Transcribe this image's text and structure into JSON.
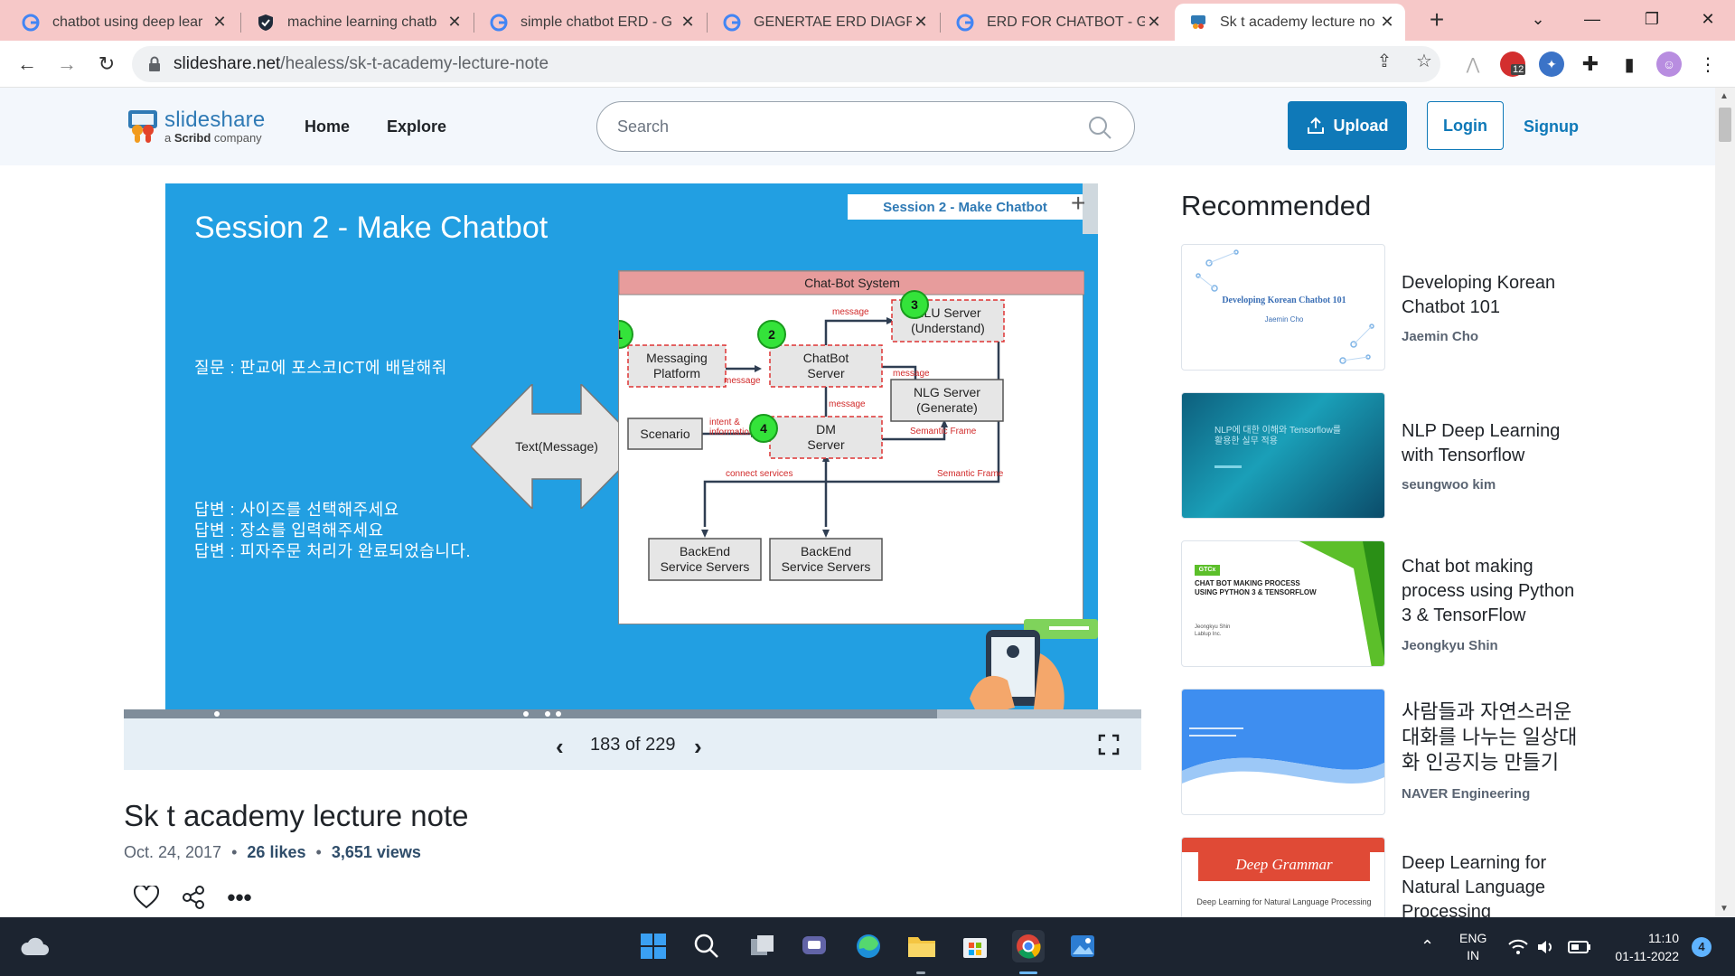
{
  "browser": {
    "tabs": [
      {
        "title": "chatbot using deep lear",
        "favicon": "google-icon"
      },
      {
        "title": "machine learning chatb",
        "favicon": "shield-icon"
      },
      {
        "title": "simple chatbot ERD - G",
        "favicon": "google-icon"
      },
      {
        "title": "GENERTAE ERD DIAGRA",
        "favicon": "google-icon"
      },
      {
        "title": "ERD FOR CHATBOT - Go",
        "favicon": "google-icon"
      },
      {
        "title": "Sk t academy lecture no",
        "favicon": "slideshare-icon",
        "active": true
      }
    ],
    "url_host": "slideshare.net",
    "url_path": "/healess/sk-t-academy-lecture-note",
    "extension_badge": "12"
  },
  "header": {
    "logo_name": "slideshare",
    "logo_sub_prefix": "a ",
    "logo_sub_brand": "Scribd",
    "logo_sub_suffix": " company",
    "nav": [
      "Home",
      "Explore"
    ],
    "search_placeholder": "Search",
    "upload_label": "Upload",
    "login_label": "Login",
    "signup_label": "Signup",
    "brand_color": "#0f79b8"
  },
  "slide": {
    "title": "Session 2 - Make Chatbot",
    "tag": "Session 2 - Make Chatbot",
    "question": "질문 : 판교에 포스코ICT에 배달해줘",
    "answers": [
      "답변 : 사이즈를 선택해주세요",
      "답변 : 장소를 입력해주세요",
      "답변 : 피자주문 처리가 완료되었습니다."
    ],
    "diagram": {
      "title": "Chat-Bot System",
      "nodes": {
        "messaging": [
          "Messaging",
          "Platform"
        ],
        "chatbot": [
          "ChatBot",
          "Server"
        ],
        "nlu": [
          "NLU Server",
          "(Understand)"
        ],
        "nlg": [
          "NLG Server",
          "(Generate)"
        ],
        "dm": [
          "DM",
          "Server"
        ],
        "scenario": "Scenario",
        "backend1": [
          "BackEnd",
          "Service Servers"
        ],
        "backend2": [
          "BackEnd",
          "Service Servers"
        ],
        "text_message": "Text(Message)"
      },
      "markers": [
        "1",
        "2",
        "3",
        "4"
      ],
      "edge_labels": {
        "msg_top": "message",
        "msg_left": "message",
        "msg_nlg": "message",
        "msg_down": "message",
        "intent": [
          "intent &",
          "information"
        ],
        "semantic1": "Semantic Frame",
        "semantic2": "Semantic Frame",
        "connect": "connect services"
      }
    }
  },
  "viewer": {
    "current_page": 183,
    "total_pages": 229,
    "page_label": "183 of 229",
    "progress_fraction": 0.799
  },
  "document": {
    "title": "Sk t academy lecture note",
    "date": "Oct. 24, 2017",
    "likes": "26 likes",
    "views": "3,651 views"
  },
  "recommended": {
    "heading": "Recommended",
    "items": [
      {
        "title": "Developing Korean Chatbot 101",
        "author": "Jaemin Cho",
        "thumb_title": "Developing Korean Chatbot 101",
        "thumb_author": "Jaemin Cho"
      },
      {
        "title": "NLP Deep Learning with Tensorflow",
        "author": "seungwoo kim",
        "thumb_title": "NLP에 대한 이해와 Tensorflow를 활용한 실무 적용"
      },
      {
        "title": "Chat bot making process using Python 3 & TensorFlow",
        "author": "Jeongkyu Shin",
        "thumb_title": "CHAT BOT MAKING PROCESS USING PYTHON 3 & TENSORFLOW",
        "thumb_badge": "GTCx",
        "thumb_author": "Jeongkyu Shin",
        "thumb_org": "Lablup Inc."
      },
      {
        "title": "사람들과 자연스러운 대화를 나누는 일상대화 인공지능 만들기",
        "author": "NAVER Engineering"
      },
      {
        "title": "Deep Learning for Natural Language Processing",
        "author": "",
        "thumb_title": "Deep Grammar",
        "thumb_sub": "Deep Learning for Natural Language Processing"
      }
    ]
  },
  "taskbar": {
    "lang_top": "ENG",
    "lang_bottom": "IN",
    "time": "11:10",
    "date": "01-11-2022",
    "notif_count": "4"
  }
}
